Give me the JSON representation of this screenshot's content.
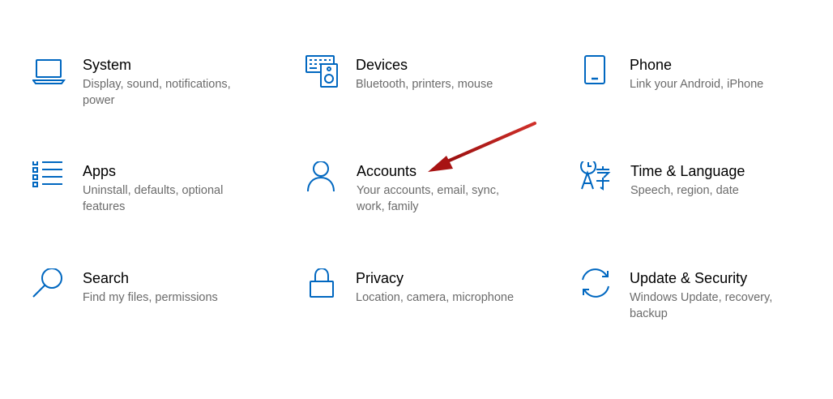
{
  "accent_color": "#0067c0",
  "arrow_color": "#b01515",
  "tiles": [
    {
      "id": "system",
      "icon": "laptop-icon",
      "title": "System",
      "desc": "Display, sound, notifications, power"
    },
    {
      "id": "devices",
      "icon": "keyboard-speaker-icon",
      "title": "Devices",
      "desc": "Bluetooth, printers, mouse"
    },
    {
      "id": "phone",
      "icon": "phone-icon",
      "title": "Phone",
      "desc": "Link your Android, iPhone"
    },
    {
      "id": "apps",
      "icon": "apps-list-icon",
      "title": "Apps",
      "desc": "Uninstall, defaults, optional features"
    },
    {
      "id": "accounts",
      "icon": "person-icon",
      "title": "Accounts",
      "desc": "Your accounts, email, sync, work, family"
    },
    {
      "id": "time-language",
      "icon": "time-language-icon",
      "title": "Time & Language",
      "desc": "Speech, region, date"
    },
    {
      "id": "search",
      "icon": "search-icon",
      "title": "Search",
      "desc": "Find my files, permissions"
    },
    {
      "id": "privacy",
      "icon": "lock-icon",
      "title": "Privacy",
      "desc": "Location, camera, microphone"
    },
    {
      "id": "update-security",
      "icon": "sync-icon",
      "title": "Update & Security",
      "desc": "Windows Update, recovery, backup"
    }
  ]
}
